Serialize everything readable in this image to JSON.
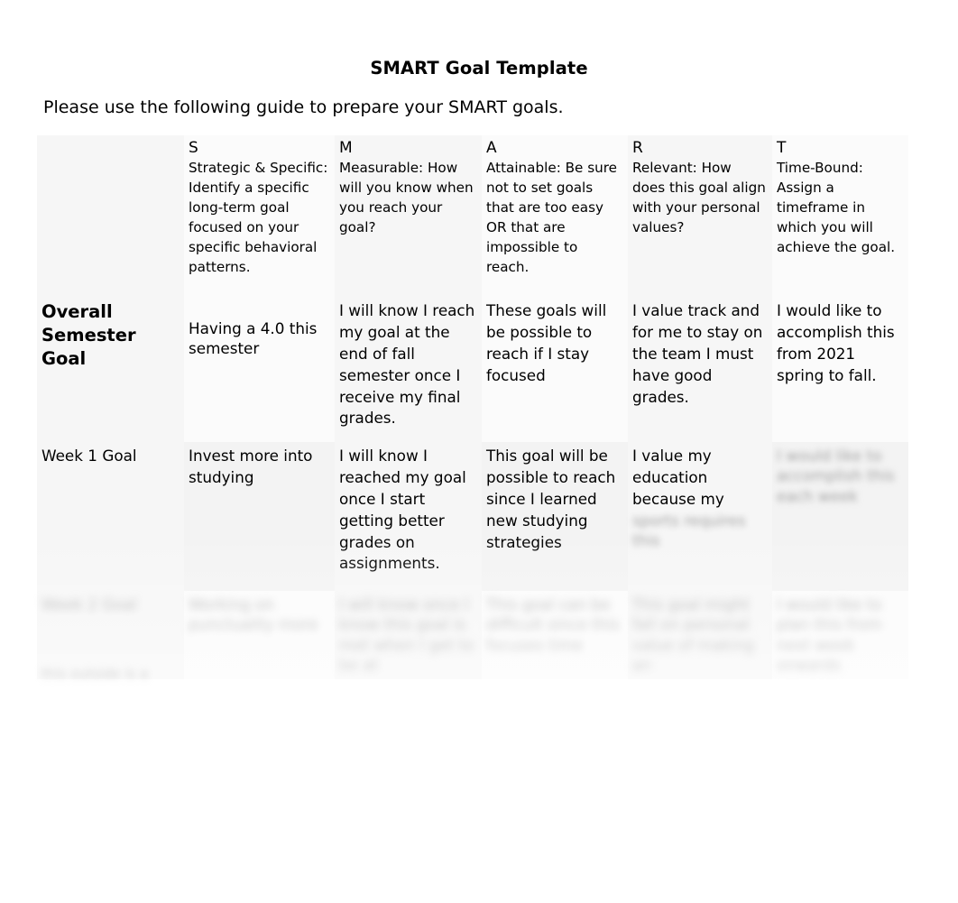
{
  "document": {
    "title": "SMART Goal Template",
    "intro": "Please use the following guide to prepare your SMART goals."
  },
  "table": {
    "columns": [
      {
        "letter": "",
        "description": ""
      },
      {
        "letter": "S",
        "description": "Strategic & Specific: Identify a specific long-term goal focused on your specific behavioral patterns."
      },
      {
        "letter": "M",
        "description": "Measurable: How will you know when you reach your goal?"
      },
      {
        "letter": "A",
        "description": "Attainable: Be sure not to set goals that are too easy OR that are impossible to reach."
      },
      {
        "letter": "R",
        "description": "Relevant: How does this goal align with your personal values?"
      },
      {
        "letter": "T",
        "description": "Time-Bound: Assign a timeframe in which you will achieve the goal."
      }
    ],
    "rows": [
      {
        "label": "Overall Semester Goal",
        "label_style": "bold",
        "s": "Having a 4.0 this semester",
        "m": "I will know I reach my goal at the end of fall semester once I receive my final grades.",
        "a": "These goals will be possible to reach if I stay focused",
        "r": "I value track and for me to stay on the team I must have good grades.",
        "t": "I would like to accomplish this from 2021 spring to fall."
      },
      {
        "label": "Week 1 Goal",
        "label_style": "regular",
        "s": "Invest more into studying",
        "m": "I will know I reached my goal once I start getting better grades on assignments.",
        "a": "This goal will be possible to reach since I learned new studying strategies",
        "r_visible": "I value my education because my",
        "r_redacted": "sports requires this",
        "t_redacted": "I would like to accomplish this each week"
      },
      {
        "label_redacted": "Week 2 Goal",
        "label_style": "regular",
        "s_redacted": "Working on punctuality more",
        "m_redacted": "I will know once I know this goal is met when I get to be at",
        "a_redacted": "This goal can be difficult since this focuses time",
        "r_redacted": "This goal might fall on personal value of making an",
        "t_redacted": "I would like to plan this from next week onwards"
      }
    ]
  },
  "footnote_redacted": "this outside is a"
}
